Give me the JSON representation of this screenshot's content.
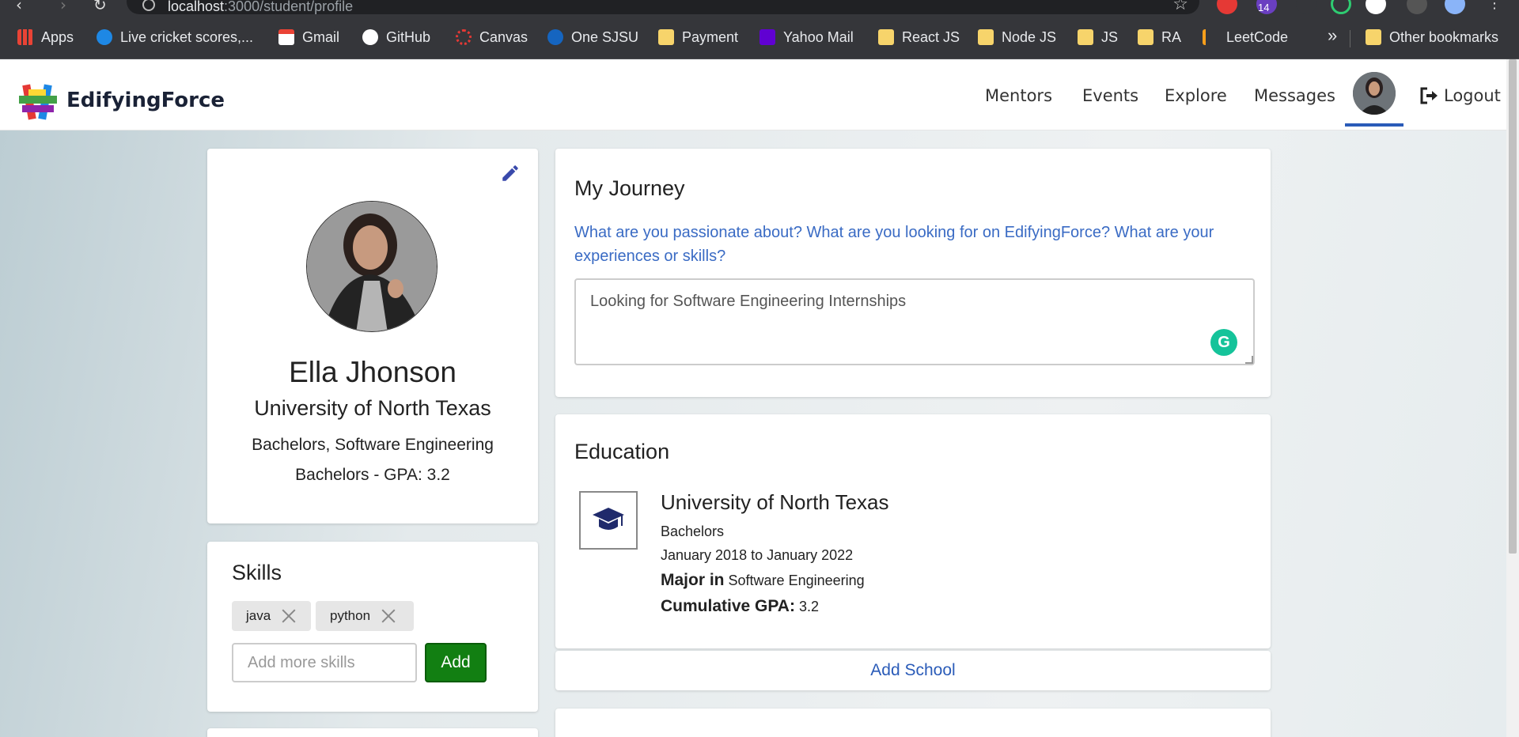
{
  "browser": {
    "url_host": "localhost",
    "url_path": ":3000/student/profile",
    "extension_badge": "14",
    "bookmarks": [
      {
        "label": "Apps"
      },
      {
        "label": "Live cricket scores,..."
      },
      {
        "label": "Gmail"
      },
      {
        "label": "GitHub"
      },
      {
        "label": "Canvas"
      },
      {
        "label": "One SJSU"
      },
      {
        "label": "Payment"
      },
      {
        "label": "Yahoo Mail"
      },
      {
        "label": "React JS"
      },
      {
        "label": "Node JS"
      },
      {
        "label": "JS"
      },
      {
        "label": "RA"
      },
      {
        "label": "LeetCode"
      }
    ],
    "more_bookmarks": "»",
    "other_bookmarks": "Other bookmarks"
  },
  "header": {
    "brand": "EdifyingForce",
    "nav": [
      "Mentors",
      "Events",
      "Explore",
      "Messages"
    ],
    "logout": "Logout"
  },
  "profile": {
    "name": "Ella Jhonson",
    "university": "University of North Texas",
    "degree": "Bachelors, Software Engineering",
    "gpa_line": "Bachelors - GPA: 3.2"
  },
  "skills": {
    "title": "Skills",
    "items": [
      "java",
      "python"
    ],
    "input_placeholder": "Add more skills",
    "add_label": "Add"
  },
  "journey": {
    "title": "My Journey",
    "prompt": "What are you passionate about? What are you looking for on EdifyingForce? What are your experiences or skills?",
    "text": "Looking for Software Engineering Internships"
  },
  "education": {
    "title": "Education",
    "school": "University of North Texas",
    "degree": "Bachelors",
    "dates": "January 2018 to January 2022",
    "major_label": "Major in",
    "major": "Software Engineering",
    "gpa_label": "Cumulative GPA:",
    "gpa": "3.2",
    "add_school": "Add School"
  },
  "colors": {
    "accent": "#2a5bb8",
    "add_button": "#127f12",
    "grammarly": "#15c39a"
  }
}
